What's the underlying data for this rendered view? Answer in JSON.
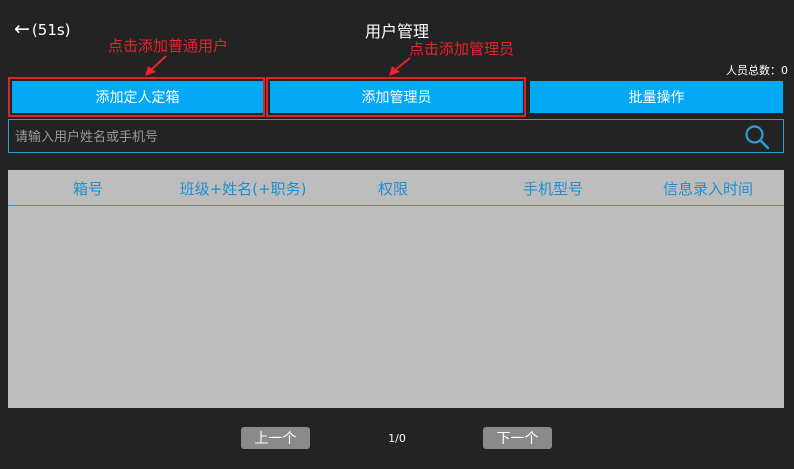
{
  "header": {
    "back_label": "(51s)",
    "title": "用户管理",
    "total_count": "人员总数：0"
  },
  "annotations": {
    "add_user_hint": "点击添加普通用户",
    "add_admin_hint": "点击添加管理员",
    "color": "#e8232a"
  },
  "actions": {
    "add_user": "添加定人定箱",
    "add_admin": "添加管理员",
    "batch": "批量操作"
  },
  "search": {
    "placeholder": "请输入用户姓名或手机号",
    "value": ""
  },
  "table": {
    "columns": [
      "箱号",
      "班级+姓名(+职务)",
      "权限",
      "手机型号",
      "信息录入时间"
    ],
    "rows": []
  },
  "pagination": {
    "prev": "上一个",
    "indicator": "1/0",
    "next": "下一个"
  },
  "colors": {
    "accent": "#03a9f4",
    "background": "#232323",
    "table_bg": "#bdbdbd",
    "header_text": "#1e8fd1",
    "highlight": "#d9262c"
  }
}
